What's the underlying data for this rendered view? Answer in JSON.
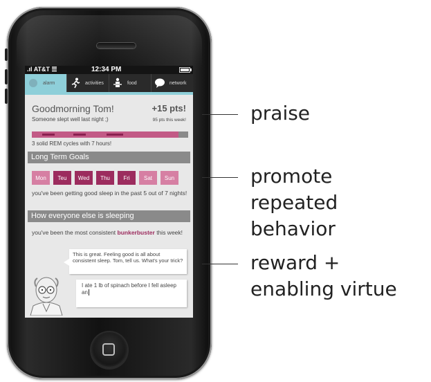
{
  "status_bar": {
    "carrier": "AT&T",
    "time": "12:34 PM"
  },
  "tabs": [
    {
      "label": "alarm",
      "icon": "alarm-icon",
      "active": true
    },
    {
      "label": "activities",
      "icon": "running-person-icon",
      "active": false
    },
    {
      "label": "food",
      "icon": "person-eating-icon",
      "active": false
    },
    {
      "label": "network",
      "icon": "speech-bubble-icon",
      "active": false
    }
  ],
  "praise": {
    "title": "Goodmorning Tom!",
    "points": "+15 pts!",
    "subtitle": "Someone slept well last night ;)",
    "week_points": "95 pts this week!",
    "rem_text": "3 solid REM cycles with 7 hours!"
  },
  "long_term_goals": {
    "header": "Long Term Goals",
    "days": [
      {
        "label": "Mon",
        "strong": false
      },
      {
        "label": "Teu",
        "strong": true
      },
      {
        "label": "Wed",
        "strong": true
      },
      {
        "label": "Thu",
        "strong": true
      },
      {
        "label": "Fri",
        "strong": true
      },
      {
        "label": "Sat",
        "strong": false
      },
      {
        "label": "Sun",
        "strong": false
      }
    ],
    "text": "you've been getting good sleep in the past 5 out of 7 nights!"
  },
  "others": {
    "header": "How everyone else is sleeping",
    "text_before": "you've been the most consistent ",
    "highlight_name": "bunkerbuster",
    "text_after": " this week!"
  },
  "chat": {
    "coach_message": "This is great. Feeling good is all about consistent sleep. Tom, tell us. What's your trick?",
    "reply_value": "I ate 1 lb of spinach before I fell asleep an"
  },
  "annotations": {
    "praise": "praise",
    "promote_line1": "promote",
    "promote_line2": "repeated",
    "promote_line3": "behavior",
    "reward_line1": "reward +",
    "reward_line2": "enabling virtue"
  },
  "colors": {
    "accent_cyan": "#8ecfd9",
    "magenta": "#9c2c5e",
    "light_magenta": "#d67fa3",
    "header_grey": "#8a8a8a"
  }
}
